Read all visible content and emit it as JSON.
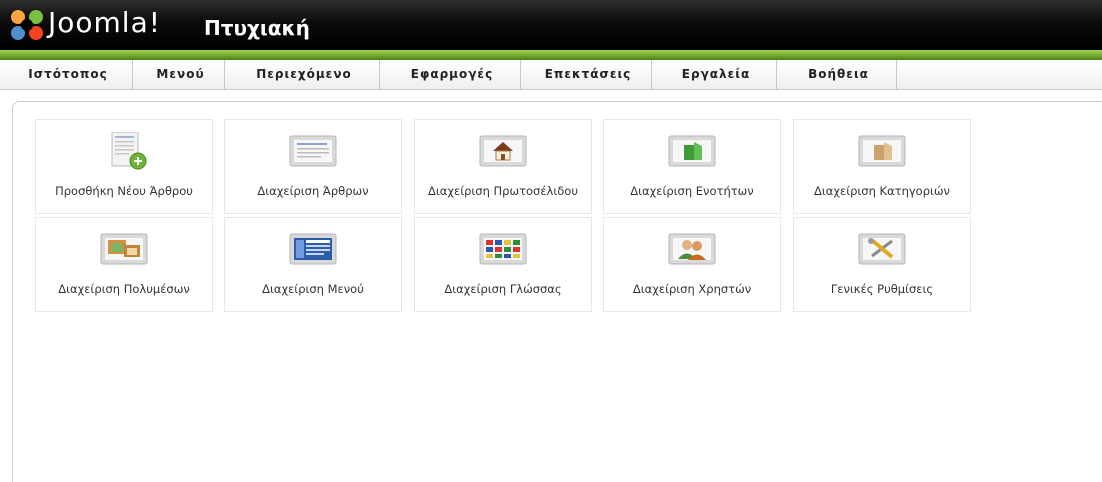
{
  "header": {
    "brand": "Joomla!",
    "site_name": "Πτυχιακή"
  },
  "menu": [
    "Ιστότοπος",
    "Μενού",
    "Περιεχόμενο",
    "Εφαρμογές",
    "Επεκτάσεις",
    "Εργαλεία",
    "Βοήθεια"
  ],
  "cpanel": [
    {
      "label": "Προσθήκη Νέου Άρθρου",
      "icon": "add-article-icon"
    },
    {
      "label": "Διαχείριση Άρθρων",
      "icon": "article-manager-icon"
    },
    {
      "label": "Διαχείριση Πρωτοσέλιδου",
      "icon": "frontpage-manager-icon"
    },
    {
      "label": "Διαχείριση Ενοτήτων",
      "icon": "section-manager-icon"
    },
    {
      "label": "Διαχείριση Κατηγοριών",
      "icon": "category-manager-icon"
    },
    {
      "label": "Διαχείριση Πολυμέσων",
      "icon": "media-manager-icon"
    },
    {
      "label": "Διαχείριση Μενού",
      "icon": "menu-manager-icon"
    },
    {
      "label": "Διαχείριση Γλώσσας",
      "icon": "language-manager-icon"
    },
    {
      "label": "Διαχείριση Χρηστών",
      "icon": "user-manager-icon"
    },
    {
      "label": "Γενικές Ρυθμίσεις",
      "icon": "global-config-icon"
    }
  ]
}
